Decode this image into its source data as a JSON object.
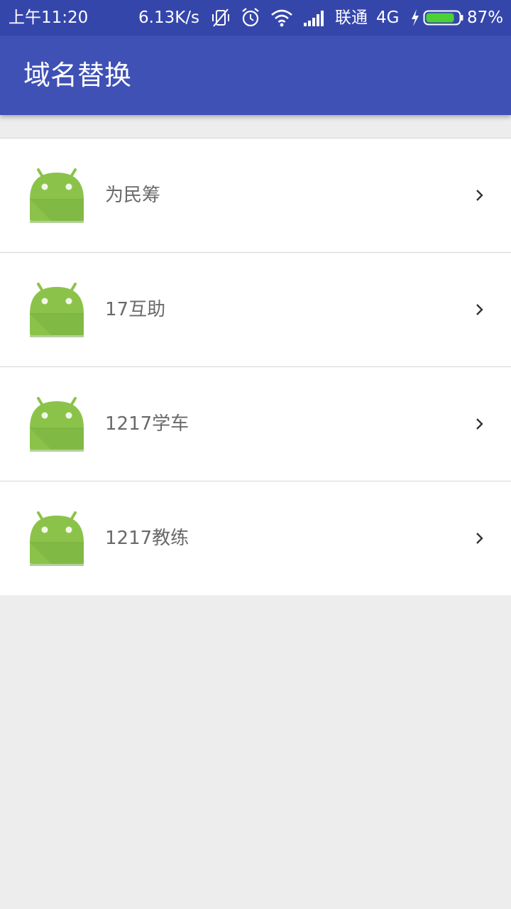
{
  "status_bar": {
    "time": "上午11:20",
    "net_speed": "6.13K/s",
    "carrier": "联通",
    "network_type": "4G",
    "battery_percent": "87%",
    "battery_level": 0.87,
    "icons": [
      "vibrate-off-icon",
      "alarm-icon",
      "wifi-icon",
      "signal-icon",
      "charging-icon",
      "battery-icon"
    ]
  },
  "app_bar": {
    "title": "域名替换"
  },
  "list": {
    "items": [
      {
        "label": "为民筹",
        "icon": "android-icon"
      },
      {
        "label": "17互助",
        "icon": "android-icon"
      },
      {
        "label": "1217学车",
        "icon": "android-icon"
      },
      {
        "label": "1217教练",
        "icon": "android-icon"
      }
    ],
    "chevron_icon": "chevron-right-icon"
  },
  "colors": {
    "status_bar": "#3546ab",
    "app_bar": "#3f51b5",
    "background": "#ededed",
    "android_green": "#8bc34a",
    "label_text": "#6a6a6a",
    "battery_fill": "#4cd137"
  }
}
